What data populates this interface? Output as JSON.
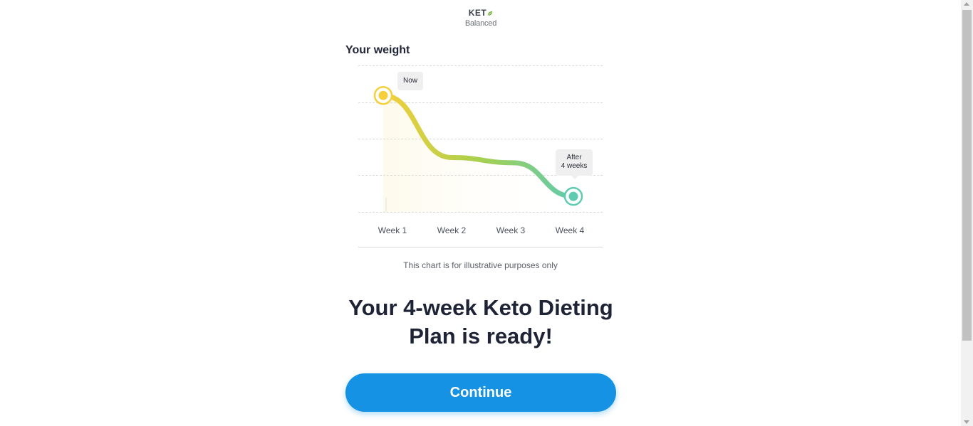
{
  "logo": {
    "top_text": "KET",
    "bottom_text": "Balanced",
    "leaf_icon": "leaf-icon"
  },
  "chart_section": {
    "title": "Your weight",
    "disclaimer": "This chart is for illustrative purposes only",
    "bubbles": {
      "now": "Now",
      "after_line1": "After",
      "after_line2": "4 weeks"
    }
  },
  "chart_data": {
    "type": "line",
    "categories": [
      "Week 1",
      "Week 2",
      "Week 3",
      "Week 4"
    ],
    "series": [
      {
        "values": [
          4.5,
          2.1,
          1.9,
          0.6
        ]
      }
    ],
    "ylim": [
      0,
      5
    ],
    "grid": true,
    "colors": {
      "start": "#f5cf3c",
      "mid": "#a8d04e",
      "end": "#5fcbb0"
    }
  },
  "headline": "Your 4-week Keto Dieting Plan is ready!",
  "cta": {
    "label": "Continue",
    "color": "#1592e3"
  }
}
